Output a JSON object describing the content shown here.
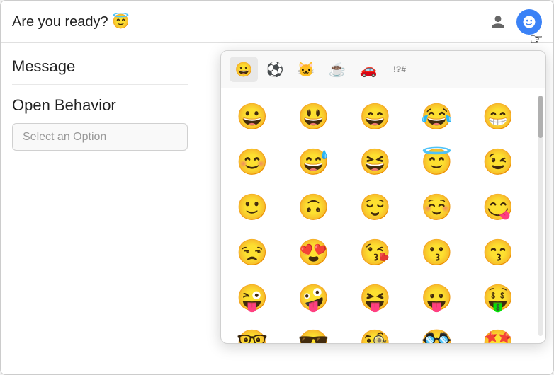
{
  "header": {
    "title": "Are you ready? 😇",
    "person_icon_label": "person",
    "emoji_icon_label": "emoji"
  },
  "left_panel": {
    "message_label": "Message",
    "open_behavior_label": "Open Behavior",
    "select_placeholder": "Select an Option"
  },
  "emoji_picker": {
    "tabs": [
      {
        "id": "smiley",
        "icon": "😀",
        "active": true
      },
      {
        "id": "sports",
        "icon": "⚽"
      },
      {
        "id": "animals",
        "icon": "🐱"
      },
      {
        "id": "food",
        "icon": "☕"
      },
      {
        "id": "travel",
        "icon": "🚗"
      },
      {
        "id": "symbols",
        "label": "!?#"
      }
    ],
    "emojis": [
      "😀",
      "😃",
      "😄",
      "😂",
      "😁",
      "😊",
      "😅",
      "😆",
      "😇",
      "😉",
      "🙂",
      "🙃",
      "😌",
      "☺️",
      "😋",
      "😒",
      "😍",
      "😘",
      "😗",
      "😙",
      "😜",
      "🤪",
      "😝",
      "😛",
      "🤑",
      "🤓",
      "😎",
      "🧐",
      "🥸",
      "🤩"
    ]
  }
}
